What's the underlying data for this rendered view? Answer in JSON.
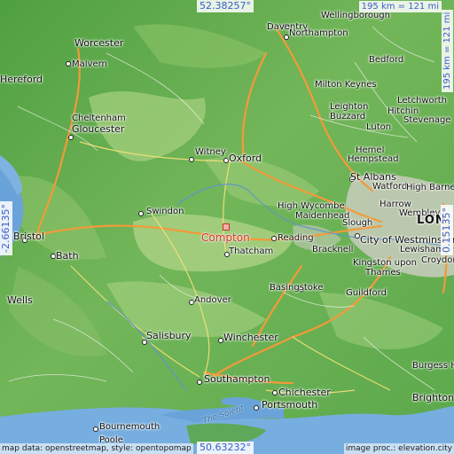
{
  "map": {
    "center_latitude": "52.38257°",
    "south_latitude": "50.63232°",
    "west_longitude": "-2.66135°",
    "east_longitude": "0.15135°",
    "scale_horizontal": "195 km = 121 mi",
    "scale_vertical": "195 km = 121 mi",
    "credit_left": "map data: openstreetmap, style: opentopomap",
    "credit_right": "image proc.: elevation.city",
    "sea_label": "The Solent",
    "highlight": {
      "name": "Compton"
    },
    "places": [
      {
        "name": "Daventry"
      },
      {
        "name": "Wellingborough"
      },
      {
        "name": "Northampton"
      },
      {
        "name": "Bedford"
      },
      {
        "name": "Worcester"
      },
      {
        "name": "Malvern"
      },
      {
        "name": "Hereford"
      },
      {
        "name": "Milton Keynes"
      },
      {
        "name": "Letchworth"
      },
      {
        "name": "Leighton"
      },
      {
        "name": "Buzzard"
      },
      {
        "name": "Hitchin"
      },
      {
        "name": "Stevenage"
      },
      {
        "name": "Cheltenham"
      },
      {
        "name": "Gloucester"
      },
      {
        "name": "Luton"
      },
      {
        "name": "Hemel"
      },
      {
        "name": "Hempstead"
      },
      {
        "name": "Witney"
      },
      {
        "name": "Oxford"
      },
      {
        "name": "St Albans"
      },
      {
        "name": "Watford"
      },
      {
        "name": "High Barnet"
      },
      {
        "name": "High Wycombe"
      },
      {
        "name": "Harrow"
      },
      {
        "name": "Maidenhead"
      },
      {
        "name": "Wembley"
      },
      {
        "name": "Swindon"
      },
      {
        "name": "Slough"
      },
      {
        "name": "LON"
      },
      {
        "name": "Bristol"
      },
      {
        "name": "Reading"
      },
      {
        "name": "City of Westminster"
      },
      {
        "name": "Bracknell"
      },
      {
        "name": "Lewisham"
      },
      {
        "name": "Thatcham"
      },
      {
        "name": "Bath"
      },
      {
        "name": "Kingston upon"
      },
      {
        "name": "Thames"
      },
      {
        "name": "Croydon"
      },
      {
        "name": "Basingstoke"
      },
      {
        "name": "Guildford"
      },
      {
        "name": "Wells"
      },
      {
        "name": "Andover"
      },
      {
        "name": "Salisbury"
      },
      {
        "name": "Winchester"
      },
      {
        "name": "Burgess Hi"
      },
      {
        "name": "Southampton"
      },
      {
        "name": "Chichester"
      },
      {
        "name": "Portsmouth"
      },
      {
        "name": "Brighton"
      },
      {
        "name": "Bournemouth"
      },
      {
        "name": "Poole"
      }
    ]
  }
}
